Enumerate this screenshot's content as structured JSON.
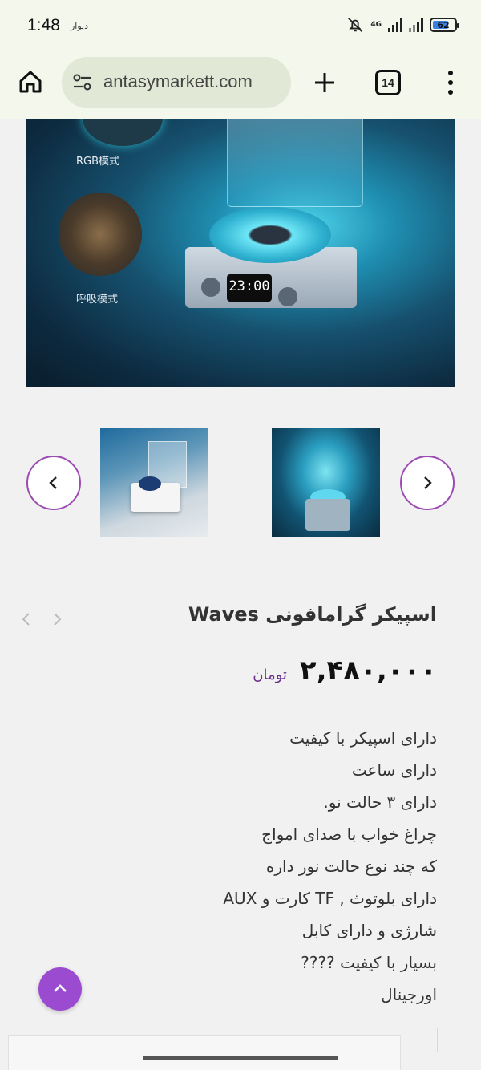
{
  "status": {
    "time": "1:48",
    "app_label": "دیوار",
    "network": "4G",
    "battery": "62",
    "battery_level": 0.62,
    "battery_color": "#3b7fe0",
    "icons": [
      "mute-notification-icon",
      "signal-icon",
      "battery-icon"
    ]
  },
  "browser": {
    "url": "antasymarkett.com",
    "tab_count": "14",
    "icons": [
      "home-icon",
      "site-settings-icon",
      "new-tab-plus-icon",
      "tabs-icon",
      "more-menu-icon"
    ]
  },
  "hero": {
    "label_rgb": "RGB模式",
    "label_breath": "呼吸模式",
    "clock_display": "23:00"
  },
  "product": {
    "title": "اسپیکر گرامافونی Waves",
    "price": "۲,۴۸۰,۰۰۰",
    "currency": "تومان",
    "description": [
      "دارای اسپیکر با کیفیت",
      "دارای ساعت",
      "دارای ۳ حالت نو.",
      "چراغ خواب با صدای امواج",
      "که چند نوع حالت نور داره",
      "دارای بلوتوث , TF کارت و AUX",
      "شارژی و دارای کابل",
      "بسیار با کیفیت ????",
      "اورجینال"
    ]
  },
  "colors": {
    "accent": "#9b4bcf",
    "accent_border": "#9b4bb2",
    "price_currency": "#6a2f8c",
    "page_bg": "#f1f1f1",
    "browser_bg": "#f3f7ec",
    "url_bg": "#e1e8d6"
  }
}
